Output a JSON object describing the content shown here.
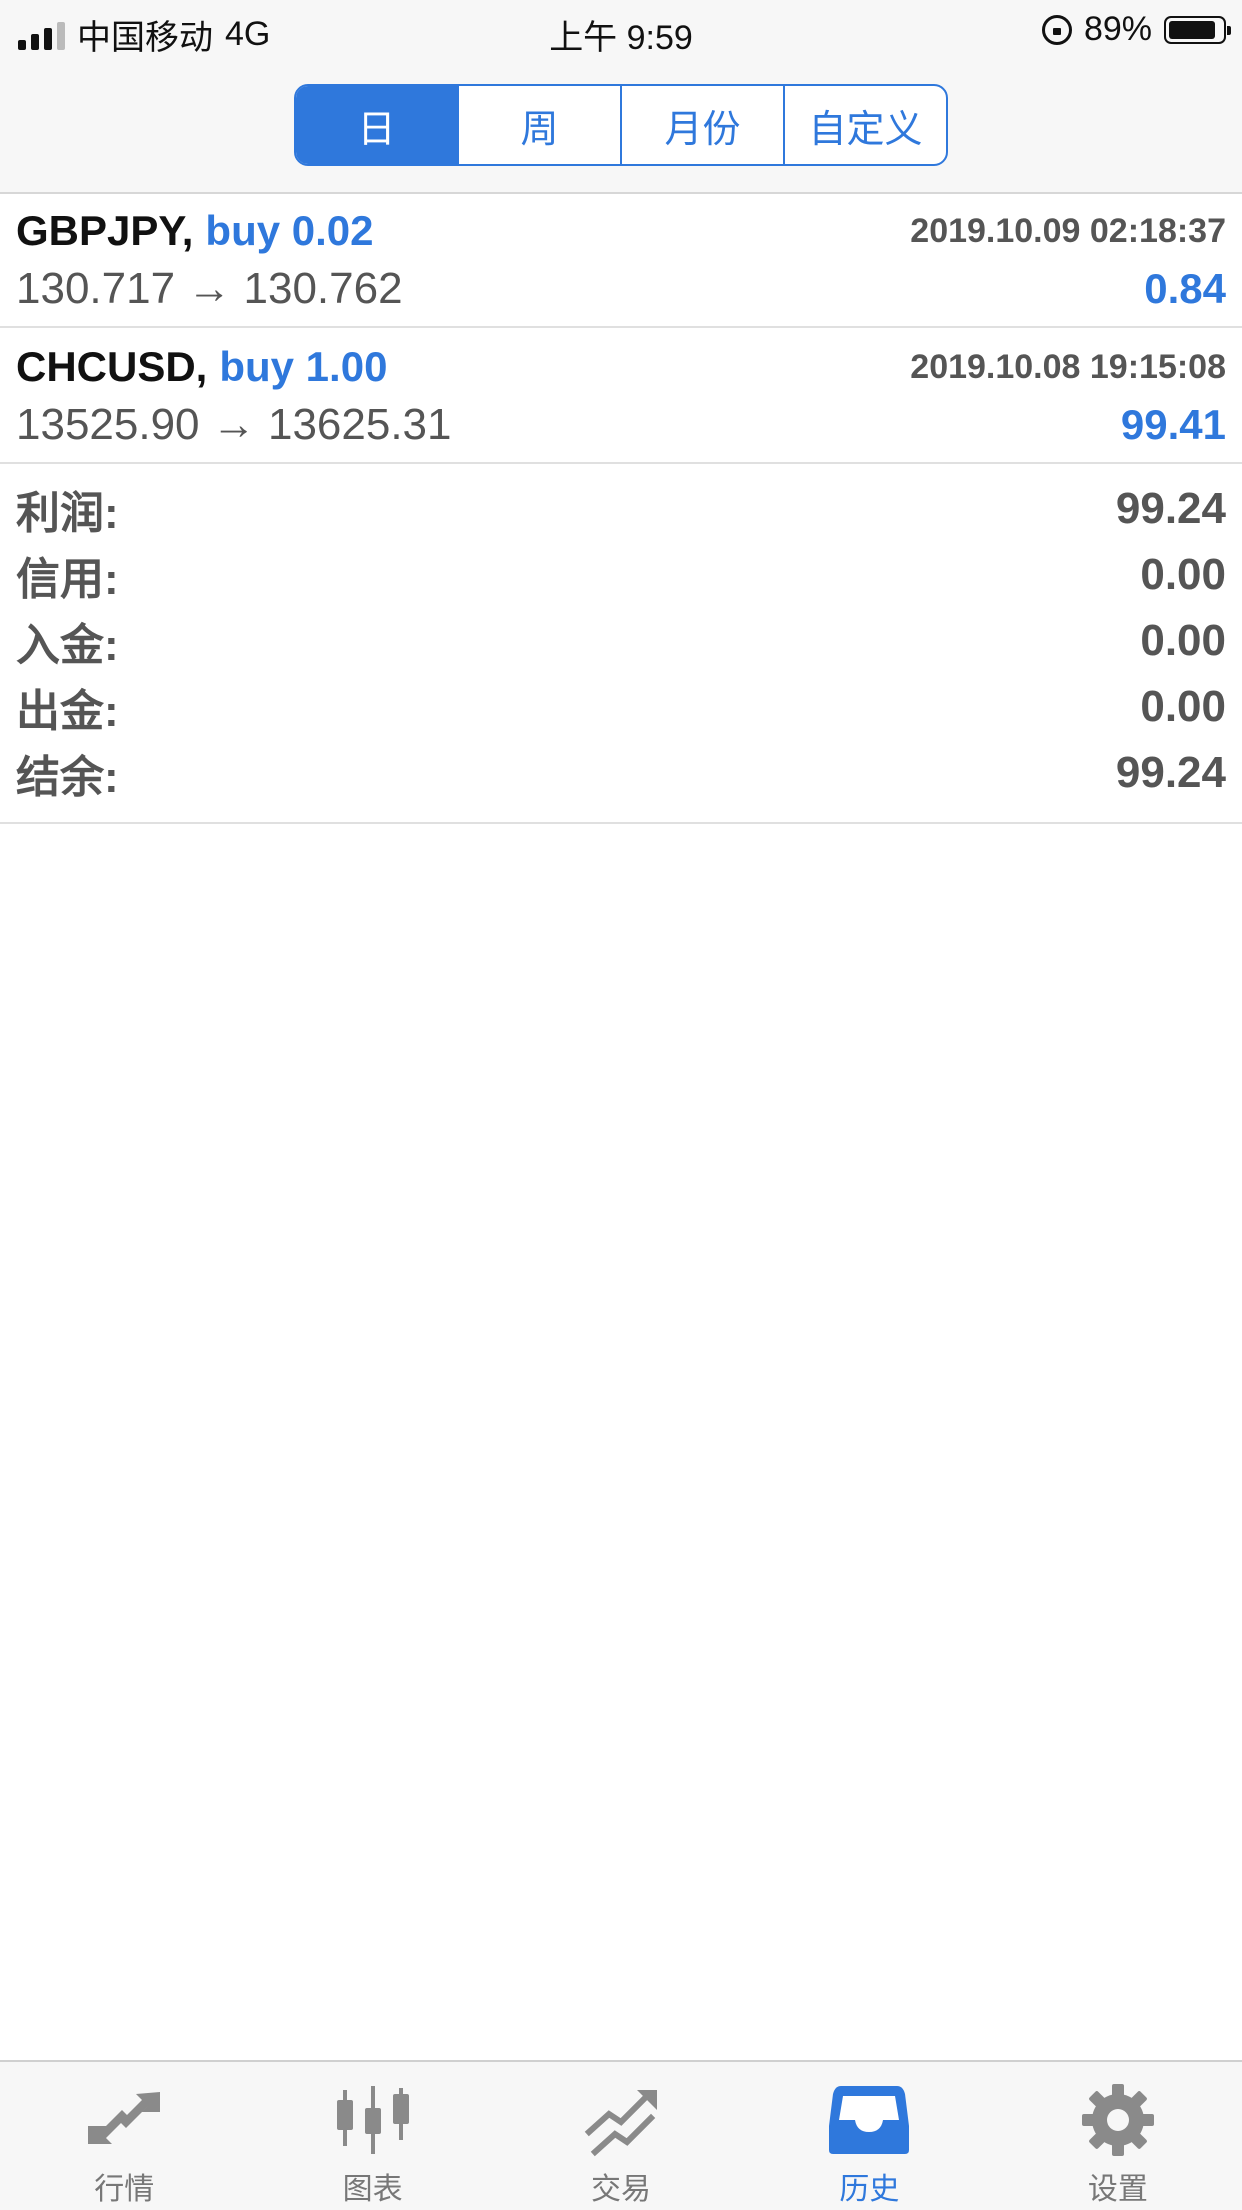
{
  "status_bar": {
    "carrier": "中国移动",
    "network": "4G",
    "time": "上午 9:59",
    "battery": "89%",
    "battery_level": 0.89
  },
  "segments": [
    {
      "label": "日",
      "active": true
    },
    {
      "label": "周",
      "active": false
    },
    {
      "label": "月份",
      "active": false
    },
    {
      "label": "自定义",
      "active": false
    }
  ],
  "trades": [
    {
      "symbol": "GBPJPY,",
      "side": "buy 0.02",
      "timestamp": "2019.10.09 02:18:37",
      "prices": "130.717 → 130.762",
      "profit": "0.84"
    },
    {
      "symbol": "CHCUSD,",
      "side": "buy 1.00",
      "timestamp": "2019.10.08 19:15:08",
      "prices": "13525.90 → 13625.31",
      "profit": "99.41"
    }
  ],
  "summary": [
    {
      "label": "利润:",
      "value": "99.24"
    },
    {
      "label": "信用:",
      "value": "0.00"
    },
    {
      "label": "入金:",
      "value": "0.00"
    },
    {
      "label": "出金:",
      "value": "0.00"
    },
    {
      "label": "结余:",
      "value": "99.24"
    }
  ],
  "tabs": [
    {
      "label": "行情",
      "icon": "quotes-arrows-icon",
      "active": false
    },
    {
      "label": "图表",
      "icon": "candlestick-chart-icon",
      "active": false
    },
    {
      "label": "交易",
      "icon": "trade-trend-icon",
      "active": false
    },
    {
      "label": "历史",
      "icon": "history-inbox-icon",
      "active": true
    },
    {
      "label": "设置",
      "icon": "gear-icon",
      "active": false
    }
  ],
  "colors": {
    "accent": "#2f78dc",
    "inactive_icon": "#8a8a8a"
  }
}
